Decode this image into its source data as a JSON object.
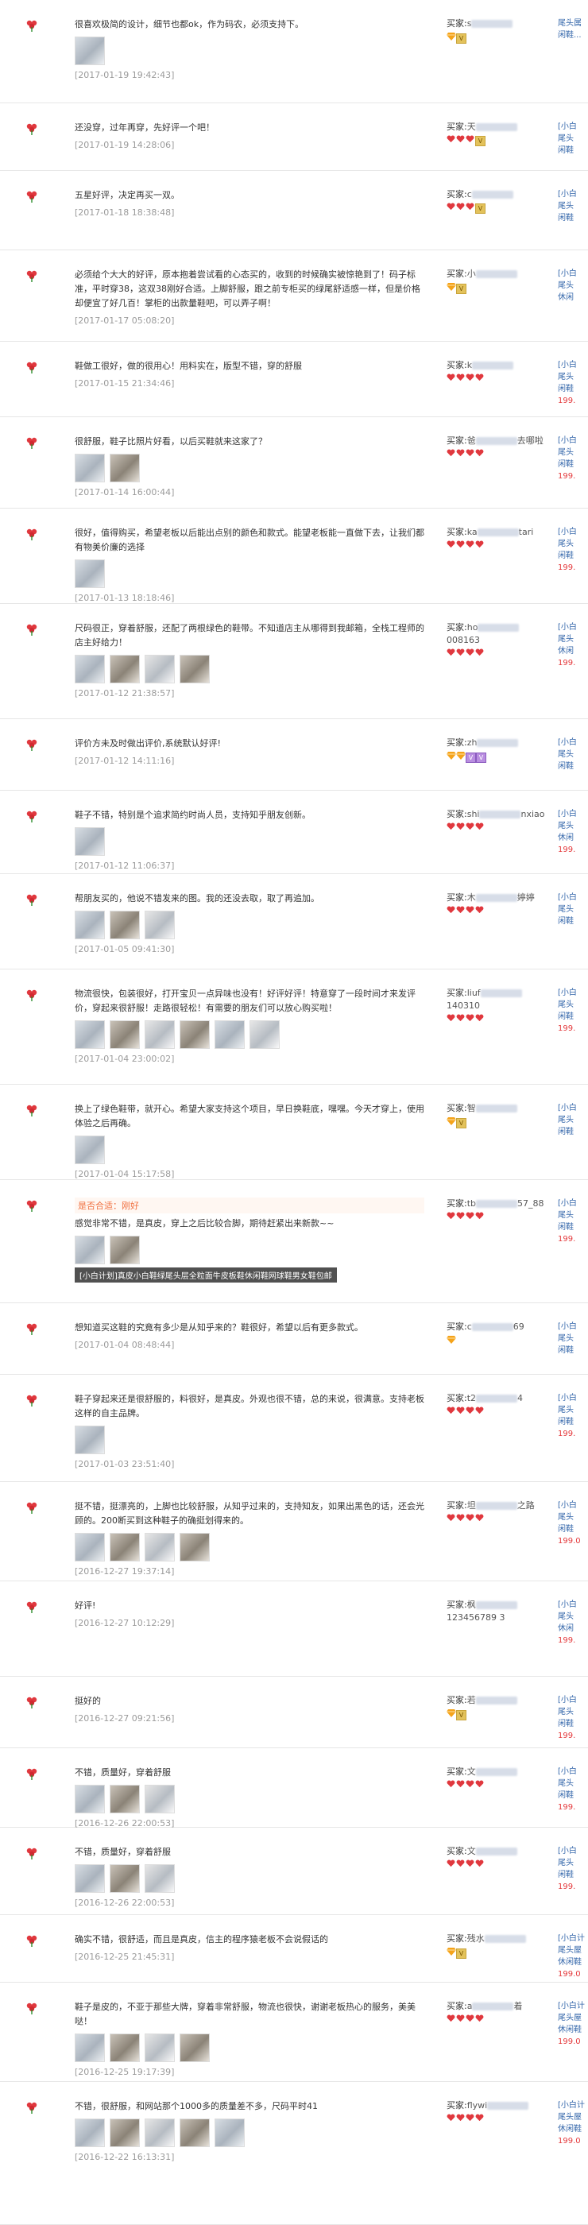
{
  "labels": {
    "buyer": "买家:",
    "append": "是否合适：刚好"
  },
  "colors": {
    "price": "#e4393c",
    "link": "#3366aa",
    "date": "#9a9a9a",
    "heart": "#e0383e",
    "gem": "#f5a31a"
  },
  "reviews": [
    {
      "text": "很喜欢极简的设计，细节也都ok，作为码农，必须支持下。",
      "date": "[2017-01-19 19:42:43]",
      "thumbs": 1,
      "buyer": "s",
      "suffix": "",
      "hearts": 0,
      "gems": 1,
      "vip": 1,
      "item": [
        "尾头属",
        "闲鞋..."
      ],
      "price": ""
    },
    {
      "text": "还没穿，过年再穿，先好评一个吧！",
      "date": "[2017-01-19 14:28:06]",
      "thumbs": 0,
      "buyer": "天",
      "suffix": "",
      "hearts": 3,
      "gems": 0,
      "vip": 1,
      "item": [
        "[小白",
        "尾头",
        "闲鞋"
      ],
      "price": ""
    },
    {
      "text": "五星好评，决定再买一双。",
      "date": "[2017-01-18 18:38:48]",
      "thumbs": 0,
      "buyer": "c",
      "suffix": "",
      "hearts": 3,
      "gems": 0,
      "vip": 1,
      "item": [
        "[小白",
        "尾头",
        "闲鞋"
      ],
      "price": ""
    },
    {
      "text": "必须给个大大的好评，原本抱着尝试看的心态买的，收到的时候确实被惊艳到了！码子标准，平时穿38，这双38刚好合适。上脚舒服，跟之前专柜买的绿尾舒适感一样，但是价格却便宜了好几百！掌柜的出款量鞋吧，可以弄子啊！",
      "date": "[2017-01-17 05:08:20]",
      "thumbs": 0,
      "buyer": "小",
      "suffix": "",
      "hearts": 0,
      "gems": 1,
      "vip": 1,
      "item": [
        "[小白",
        "尾头",
        "休闲"
      ],
      "price": ""
    },
    {
      "text": "鞋做工很好，做的很用心！用料实在，版型不错，穿的舒服",
      "date": "[2017-01-15 21:34:46]",
      "thumbs": 0,
      "buyer": "k",
      "suffix": "",
      "hearts": 4,
      "gems": 0,
      "vip": 0,
      "item": [
        "[小白",
        "尾头",
        "闲鞋"
      ],
      "price": "199."
    },
    {
      "text": "很舒服，鞋子比照片好看，以后买鞋就来这家了？",
      "date": "[2017-01-14 16:00:44]",
      "thumbs": 2,
      "buyer": "爸",
      "suffix": "去哪啦",
      "hearts": 4,
      "gems": 0,
      "vip": 0,
      "item": [
        "[小白",
        "尾头",
        "闲鞋"
      ],
      "price": "199."
    },
    {
      "text": "很好，值得购买，希望老板以后能出点别的颜色和款式。能望老板能一直做下去，让我们都有物美价廉的选择",
      "date": "[2017-01-13 18:18:46]",
      "thumbs": 1,
      "buyer": "ka",
      "suffix": "tari",
      "hearts": 4,
      "gems": 0,
      "vip": 0,
      "item": [
        "[小白",
        "尾头",
        "闲鞋"
      ],
      "price": "199."
    },
    {
      "text": "尺码很正，穿着舒服，还配了两根绿色的鞋带。不知道店主从哪得到我邮箱，全栈工程师的店主好给力！",
      "date": "[2017-01-12 21:38:57]",
      "thumbs": 4,
      "buyer": "ho",
      "suffix": "008163",
      "hearts": 4,
      "gems": 0,
      "vip": 0,
      "item": [
        "[小白",
        "尾头",
        "休闲"
      ],
      "price": "199."
    },
    {
      "text": "评价方未及时做出评价,系统默认好评!",
      "date": "[2017-01-12 14:11:16]",
      "thumbs": 0,
      "buyer": "zh",
      "suffix": "",
      "hearts": 0,
      "gems": 2,
      "vip": 2,
      "item": [
        "[小白",
        "尾头",
        "闲鞋"
      ],
      "price": ""
    },
    {
      "text": "鞋子不错，特别是个追求简约时尚人员，支持知乎朋友创新。",
      "date": "[2017-01-12 11:06:37]",
      "thumbs": 1,
      "buyer": "shi",
      "suffix": "nxiao",
      "hearts": 4,
      "gems": 0,
      "vip": 0,
      "item": [
        "[小白",
        "尾头",
        "休闲"
      ],
      "price": "199."
    },
    {
      "text": "帮朋友买的，他说不错发来的图。我的还没去取，取了再追加。",
      "date": "[2017-01-05 09:41:30]",
      "thumbs": 3,
      "buyer": "木",
      "suffix": "婷婷",
      "hearts": 4,
      "gems": 0,
      "vip": 0,
      "item": [
        "[小白",
        "尾头",
        "闲鞋"
      ],
      "price": ""
    },
    {
      "text": "物流很快，包装很好，打开宝贝一点异味也没有！好评好评！特意穿了一段时间才来发评价，穿起来很舒服！走路很轻松！有需要的朋友们可以放心购买啦！",
      "date": "[2017-01-04 23:00:02]",
      "thumbs": 6,
      "buyer": "liuf",
      "suffix": "140310",
      "hearts": 4,
      "gems": 0,
      "vip": 0,
      "item": [
        "[小白",
        "尾头",
        "闲鞋"
      ],
      "price": "199."
    },
    {
      "text": "换上了绿色鞋带，就开心。希望大家支持这个项目，早日换鞋底，嘿嘿。今天才穿上，使用体验之后再确。",
      "date": "[2017-01-04 15:17:58]",
      "thumbs": 1,
      "buyer": "智",
      "suffix": "",
      "hearts": 0,
      "gems": 1,
      "vip": 1,
      "item": [
        "[小白",
        "尾头",
        "闲鞋"
      ],
      "price": ""
    },
    {
      "text": "感觉非常不错，是真皮，穿上之后比较合脚，期待赶紧出来新款~~",
      "date": "",
      "thumbs": 2,
      "buyer": "tb",
      "suffix": "57_88",
      "hearts": 4,
      "gems": 0,
      "vip": 0,
      "item": [
        "[小白",
        "尾头",
        "闲鞋"
      ],
      "price": "199."
    },
    {
      "text": "想知道买这鞋的究竟有多少是从知乎来的？鞋很好，希望以后有更多款式。",
      "date": "[2017-01-04 08:48:44]",
      "thumbs": 0,
      "buyer": "c",
      "suffix": "69",
      "hearts": 0,
      "gems": 1,
      "vip": 0,
      "item": [
        "[小白",
        "尾头",
        "闲鞋"
      ],
      "price": ""
    },
    {
      "text": "鞋子穿起来还是很舒服的，料很好，是真皮。外观也很不错，总的来说，很满意。支持老板这样的自主品牌。",
      "date": "[2017-01-03 23:51:40]",
      "thumbs": 1,
      "buyer": "t2",
      "suffix": "4",
      "hearts": 4,
      "gems": 0,
      "vip": 0,
      "item": [
        "[小白",
        "尾头",
        "闲鞋"
      ],
      "price": "199."
    },
    {
      "text": "挺不错，挺漂亮的，上脚也比较舒服，从知乎过来的，支持知友，如果出黑色的话，还会光顾的。200断买到这种鞋子的确挺划得来的。",
      "date": "[2016-12-27 19:37:14]",
      "thumbs": 4,
      "buyer": "坦",
      "suffix": "之路",
      "hearts": 4,
      "gems": 0,
      "vip": 0,
      "item": [
        "[小白",
        "尾头",
        "闲鞋"
      ],
      "price": "199.0"
    },
    {
      "text": "好评!",
      "date": "[2016-12-27 10:12:29]",
      "thumbs": 0,
      "buyer": "枫",
      "suffix": "123456789 3",
      "hearts": 0,
      "gems": 0,
      "vip": 0,
      "item": [
        "[小白",
        "尾头",
        "休闲"
      ],
      "price": "199."
    },
    {
      "text": "挺好的",
      "date": "[2016-12-27 09:21:56]",
      "thumbs": 0,
      "buyer": "若",
      "suffix": "",
      "hearts": 0,
      "gems": 1,
      "vip": 1,
      "item": [
        "[小白",
        "尾头",
        "闲鞋"
      ],
      "price": "199."
    },
    {
      "text": "不错，质量好，穿着舒服",
      "date": "[2016-12-26 22:00:53]",
      "thumbs": 3,
      "buyer": "文",
      "suffix": "",
      "hearts": 4,
      "gems": 0,
      "vip": 0,
      "item": [
        "[小白",
        "尾头",
        "闲鞋"
      ],
      "price": "199."
    },
    {
      "text": "不错，质量好，穿着舒服",
      "date": "[2016-12-26 22:00:53]",
      "thumbs": 3,
      "buyer": "文",
      "suffix": "",
      "hearts": 4,
      "gems": 0,
      "vip": 0,
      "item": [
        "[小白",
        "尾头",
        "闲鞋"
      ],
      "price": "199."
    },
    {
      "text": "确实不错，很舒适，而且是真皮，信主的程序猿老板不会说假话的",
      "date": "[2016-12-25 21:45:31]",
      "thumbs": 0,
      "buyer": "残水",
      "suffix": "",
      "hearts": 0,
      "gems": 1,
      "vip": 1,
      "item": [
        "[小白计",
        "尾头屋",
        "休闲鞋"
      ],
      "price": "199.0"
    },
    {
      "text": "鞋子是皮的，不亚于那些大牌，穿着非常舒服，物流也很快，谢谢老板热心的服务，美美哒！",
      "date": "[2016-12-25 19:17:39]",
      "thumbs": 4,
      "buyer": "a",
      "suffix": "着",
      "hearts": 4,
      "gems": 0,
      "vip": 0,
      "item": [
        "[小白计",
        "尾头屋",
        "休闲鞋"
      ],
      "price": "199.0"
    },
    {
      "text": "不错，很舒服，和网站那个1000多的质量差不多，尺码平时41",
      "date": "[2016-12-22 16:13:31]",
      "thumbs": 5,
      "buyer": "flywi",
      "suffix": "",
      "hearts": 4,
      "gems": 0,
      "vip": 0,
      "item": [
        "[小白计",
        "尾头屋",
        "休闲鞋"
      ],
      "price": "199.0"
    }
  ],
  "tip_text": "[小白计划]真皮小白鞋绿尾头层全粒面牛皮板鞋休闲鞋网球鞋男女鞋包邮"
}
